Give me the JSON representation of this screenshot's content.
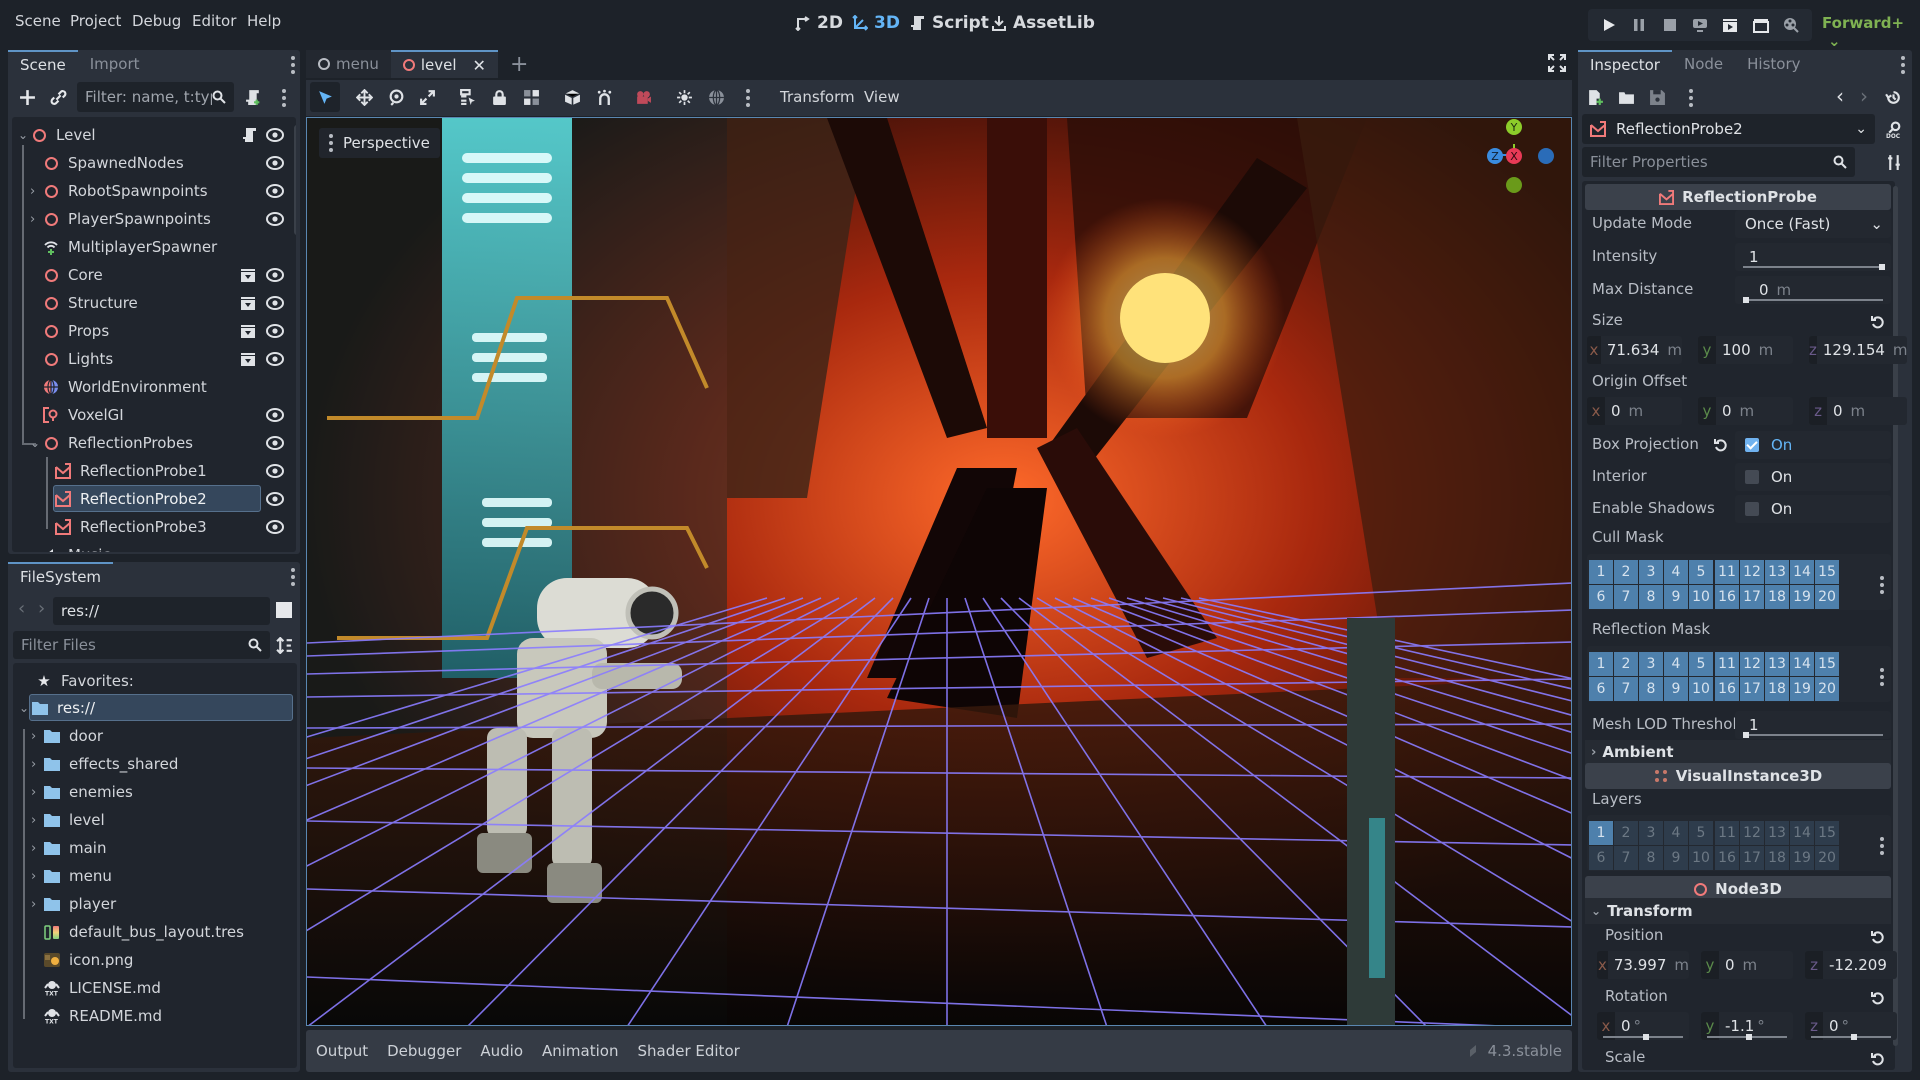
{
  "menubar": {
    "items": [
      "Scene",
      "Project",
      "Debug",
      "Editor",
      "Help"
    ],
    "main_tabs": [
      {
        "label": "2D",
        "icon": "2d-icon",
        "active": false
      },
      {
        "label": "3D",
        "icon": "3d-icon",
        "active": true
      },
      {
        "label": "Script",
        "icon": "script-icon",
        "active": false
      },
      {
        "label": "AssetLib",
        "icon": "assetlib-icon",
        "active": false
      }
    ],
    "run_buttons": [
      "play-icon",
      "pause-icon",
      "stop-icon",
      "remote-debug-icon",
      "play-current-scene-icon",
      "play-custom-scene-icon",
      "movie-maker-icon"
    ],
    "renderer": "Forward+"
  },
  "scene_dock": {
    "tabs": [
      "Scene",
      "Import"
    ],
    "filter_placeholder": "Filter: name, t:type,",
    "tree": [
      {
        "label": "Level",
        "icon": "node3d-icon",
        "depth": 0,
        "expanded": true,
        "script": true,
        "visible": true
      },
      {
        "label": "SpawnedNodes",
        "icon": "node3d-icon",
        "depth": 1,
        "visible": true
      },
      {
        "label": "RobotSpawnpoints",
        "icon": "node3d-icon",
        "depth": 1,
        "collapsed": true,
        "visible": true
      },
      {
        "label": "PlayerSpawnpoints",
        "icon": "node3d-icon",
        "depth": 1,
        "collapsed": true,
        "visible": true
      },
      {
        "label": "MultiplayerSpawner",
        "icon": "multiplayer-spawner-icon",
        "depth": 1
      },
      {
        "label": "Core",
        "icon": "node3d-icon",
        "depth": 1,
        "instanced": true,
        "visible": true
      },
      {
        "label": "Structure",
        "icon": "node3d-icon",
        "depth": 1,
        "instanced": true,
        "visible": true
      },
      {
        "label": "Props",
        "icon": "node3d-icon",
        "depth": 1,
        "instanced": true,
        "visible": true
      },
      {
        "label": "Lights",
        "icon": "node3d-icon",
        "depth": 1,
        "instanced": true,
        "visible": true
      },
      {
        "label": "WorldEnvironment",
        "icon": "world-environment-icon",
        "depth": 1
      },
      {
        "label": "VoxelGI",
        "icon": "voxelgi-icon",
        "depth": 1,
        "visible": true
      },
      {
        "label": "ReflectionProbes",
        "icon": "node3d-icon",
        "depth": 1,
        "expanded": true,
        "visible": true
      },
      {
        "label": "ReflectionProbe1",
        "icon": "reflection-probe-icon",
        "depth": 2,
        "visible": true
      },
      {
        "label": "ReflectionProbe2",
        "icon": "reflection-probe-icon",
        "depth": 2,
        "visible": true,
        "selected": true
      },
      {
        "label": "ReflectionProbe3",
        "icon": "reflection-probe-icon",
        "depth": 2,
        "visible": true
      },
      {
        "label": "Music",
        "icon": "audio-stream-player-icon",
        "depth": 1
      }
    ]
  },
  "filesystem_dock": {
    "tab": "FileSystem",
    "path": "res://",
    "filter_placeholder": "Filter Files",
    "favorites_label": "Favorites:",
    "items": [
      {
        "label": "res://",
        "type": "folder",
        "depth": 0,
        "selected": true
      },
      {
        "label": "door",
        "type": "folder",
        "depth": 1
      },
      {
        "label": "effects_shared",
        "type": "folder",
        "depth": 1
      },
      {
        "label": "enemies",
        "type": "folder",
        "depth": 1
      },
      {
        "label": "level",
        "type": "folder",
        "depth": 1
      },
      {
        "label": "main",
        "type": "folder",
        "depth": 1
      },
      {
        "label": "menu",
        "type": "folder",
        "depth": 1
      },
      {
        "label": "player",
        "type": "folder",
        "depth": 1
      },
      {
        "label": "default_bus_layout.tres",
        "type": "audio-bus-layout",
        "depth": 1
      },
      {
        "label": "icon.png",
        "type": "image",
        "depth": 1
      },
      {
        "label": "LICENSE.md",
        "type": "text",
        "depth": 1
      },
      {
        "label": "README.md",
        "type": "text",
        "depth": 1
      }
    ]
  },
  "editor": {
    "scene_tabs": [
      {
        "label": "menu",
        "active": false
      },
      {
        "label": "level",
        "active": true,
        "closable": true
      }
    ],
    "toolbar_menus": [
      "Transform",
      "View"
    ],
    "viewport_label": "Perspective",
    "gizmo_axes": [
      "Y",
      "Z",
      "X"
    ]
  },
  "bottom_panel": {
    "tabs": [
      "Output",
      "Debugger",
      "Audio",
      "Animation",
      "Shader Editor"
    ],
    "version": "4.3.stable"
  },
  "inspector": {
    "tabs": [
      "Inspector",
      "Node",
      "History"
    ],
    "object_name": "ReflectionProbe2",
    "filter_placeholder": "Filter Properties",
    "sections": {
      "reflection_probe": "ReflectionProbe",
      "visual_instance": "VisualInstance3D",
      "node3d": "Node3D"
    },
    "props": {
      "update_mode": {
        "label": "Update Mode",
        "value": "Once (Fast)"
      },
      "intensity": {
        "label": "Intensity",
        "value": "1"
      },
      "max_distance": {
        "label": "Max Distance",
        "value": "0",
        "unit": "m"
      },
      "size": {
        "label": "Size",
        "x": "71.634",
        "y": "100",
        "z": "129.154",
        "unit": "m"
      },
      "origin_offset": {
        "label": "Origin Offset",
        "x": "0",
        "y": "0",
        "z": "0",
        "unit": "m"
      },
      "box_projection": {
        "label": "Box Projection",
        "checked": true,
        "text": "On"
      },
      "interior": {
        "label": "Interior",
        "checked": false,
        "text": "On"
      },
      "enable_shadows": {
        "label": "Enable Shadows",
        "checked": false,
        "text": "On"
      },
      "cull_mask": {
        "label": "Cull Mask",
        "layers_on": [
          1,
          2,
          3,
          4,
          5,
          6,
          7,
          8,
          9,
          10,
          11,
          12,
          13,
          14,
          15,
          16,
          17,
          18,
          19,
          20
        ]
      },
      "reflection_mask": {
        "label": "Reflection Mask",
        "layers_on": [
          1,
          2,
          3,
          4,
          5,
          6,
          7,
          8,
          9,
          10,
          11,
          12,
          13,
          14,
          15,
          16,
          17,
          18,
          19,
          20
        ]
      },
      "mesh_lod_threshold": {
        "label": "Mesh LOD Threshold",
        "value": "1"
      },
      "ambient": {
        "label": "Ambient"
      },
      "layers": {
        "label": "Layers",
        "layers_on": [
          1
        ]
      },
      "transform": {
        "label": "Transform"
      },
      "position": {
        "label": "Position",
        "x": "73.997",
        "y": "0",
        "z": "-12.209",
        "unit": "m"
      },
      "rotation": {
        "label": "Rotation",
        "x": "0",
        "y": "-1.1",
        "z": "0",
        "unit": "°"
      },
      "scale": {
        "label": "Scale"
      }
    }
  },
  "colors": {
    "accent": "#64b5f6",
    "node3d": "#f07a7a",
    "renderer": "#7fb252",
    "mask_on": "#4e80ac"
  }
}
